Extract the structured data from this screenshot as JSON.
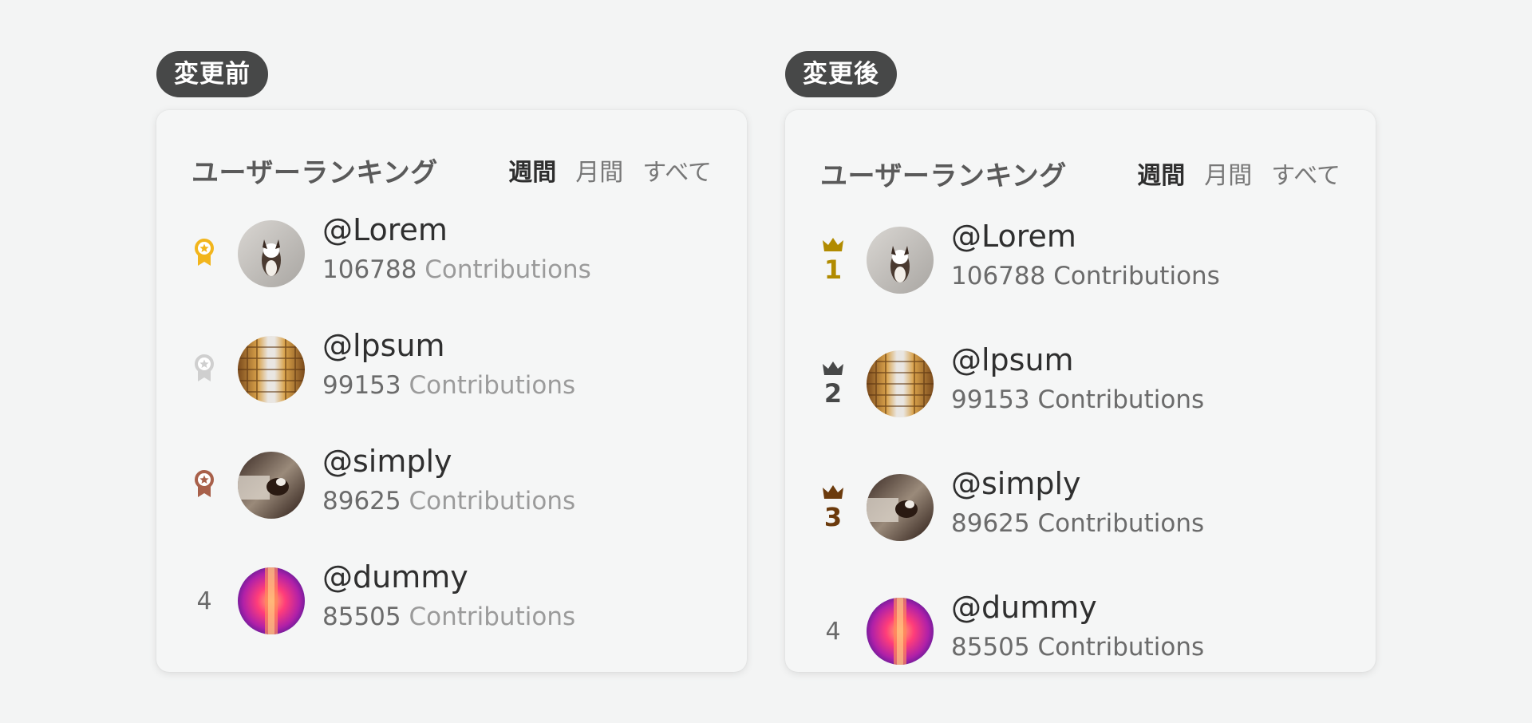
{
  "before": {
    "badge": "変更前",
    "title": "ユーザーランキング",
    "tabs": [
      {
        "label": "週間",
        "active": true
      },
      {
        "label": "月間",
        "active": false
      },
      {
        "label": "すべて",
        "active": false
      }
    ],
    "users": [
      {
        "medal": "gold-medal-icon",
        "rank": "1",
        "name": "@Lorem",
        "count": "106788",
        "unit": "Contributions",
        "avatar": "dog-photo"
      },
      {
        "medal": "silver-medal-icon",
        "rank": "2",
        "name": "@lpsum",
        "count": "99153",
        "unit": "Contributions",
        "avatar": "architecture-photo"
      },
      {
        "medal": "bronze-medal-icon",
        "rank": "3",
        "name": "@simply",
        "count": "89625",
        "unit": "Contributions",
        "avatar": "dog-photo"
      },
      {
        "medal": null,
        "rank": "4",
        "name": "@dummy",
        "count": "85505",
        "unit": "Contributions",
        "avatar": "neon-corridor-photo"
      }
    ]
  },
  "after": {
    "badge": "変更後",
    "title": "ユーザーランキング",
    "tabs": [
      {
        "label": "週間",
        "active": true
      },
      {
        "label": "月間",
        "active": false
      },
      {
        "label": "すべて",
        "active": false
      }
    ],
    "users": [
      {
        "crown": "crown-icon",
        "rank": "1",
        "rank_color": "#b18b00",
        "name": "@Lorem",
        "count": "106788",
        "unit": "Contributions",
        "avatar": "dog-photo"
      },
      {
        "crown": "crown-icon",
        "rank": "2",
        "rank_color": "#474848",
        "name": "@lpsum",
        "count": "99153",
        "unit": "Contributions",
        "avatar": "architecture-photo"
      },
      {
        "crown": "crown-icon",
        "rank": "3",
        "rank_color": "#6b3a0c",
        "name": "@simply",
        "count": "89625",
        "unit": "Contributions",
        "avatar": "dog-photo"
      },
      {
        "crown": null,
        "rank": "4",
        "name": "@dummy",
        "count": "85505",
        "unit": "Contributions",
        "avatar": "neon-corridor-photo"
      }
    ]
  },
  "colors": {
    "gold": "#f2b51c",
    "silver": "#cfcfcf",
    "bronze": "#a8604a",
    "crown_gold": "#b18b00",
    "crown_silver": "#474848",
    "crown_bronze": "#6b3a0c"
  }
}
